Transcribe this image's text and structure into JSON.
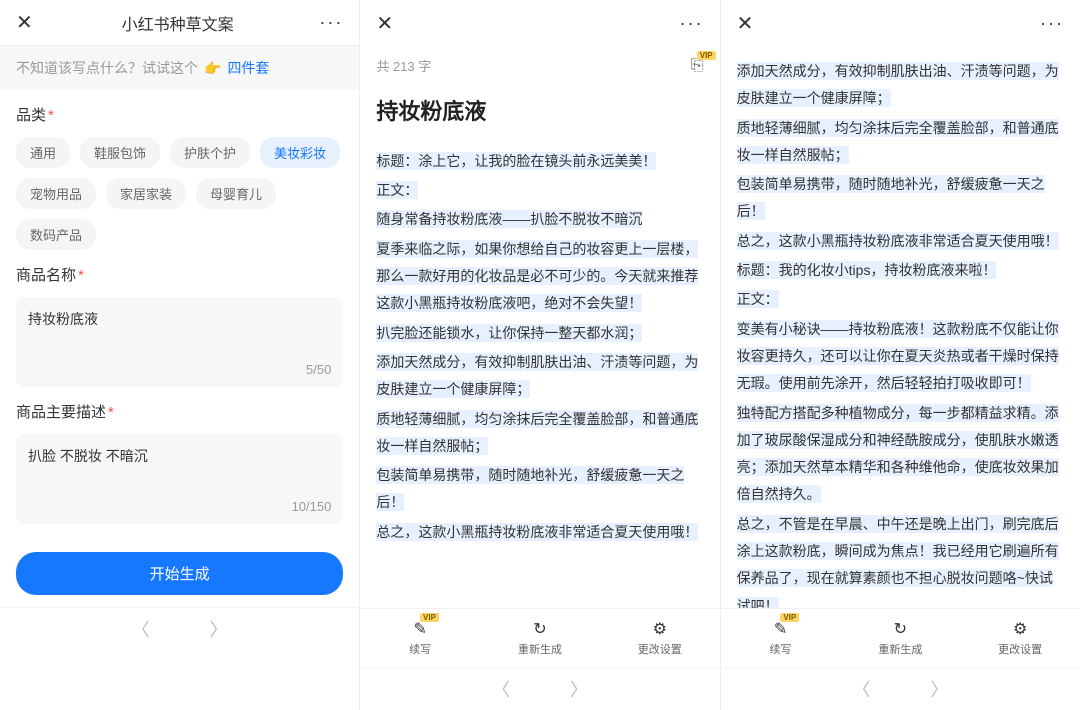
{
  "panel1": {
    "title": "小红书种草文案",
    "prompt_text": "不知道该写点什么？试试这个",
    "prompt_link": "四件套",
    "category": {
      "label": "品类",
      "chips": [
        "通用",
        "鞋服包饰",
        "护肤个护",
        "美妆彩妆",
        "宠物用品",
        "家居家装",
        "母婴育儿",
        "数码产品"
      ],
      "active_index": 3
    },
    "product_name": {
      "label": "商品名称",
      "value": "持妆粉底液",
      "counter": "5/50"
    },
    "product_desc": {
      "label": "商品主要描述",
      "value": "扒脸 不脱妆 不暗沉",
      "counter": "10/150"
    },
    "generate_button": "开始生成"
  },
  "panel2": {
    "word_count": "共 213 字",
    "vip_tag": "VIP",
    "title": "持妆粉底液",
    "paragraphs": [
      "标题：涂上它，让我的脸在镜头前永远美美！",
      "正文：",
      "随身常备持妆粉底液——扒脸不脱妆不暗沉",
      "夏季来临之际，如果你想给自己的妆容更上一层楼，那么一款好用的化妆品是必不可少的。今天就来推荐这款小黑瓶持妆粉底液吧，绝对不会失望！",
      "扒完脸还能锁水，让你保持一整天都水润；",
      "添加天然成分，有效抑制肌肤出油、汗渍等问题，为皮肤建立一个健康屏障；",
      "质地轻薄细腻，均匀涂抹后完全覆盖脸部，和普通底妆一样自然服帖；",
      "包装简单易携带，随时随地补光，舒缓疲惫一天之后！",
      "总之，这款小黑瓶持妆粉底液非常适合夏天使用哦！"
    ],
    "actions": {
      "continue": "续写",
      "regenerate": "重新生成",
      "settings": "更改设置"
    }
  },
  "panel3": {
    "paragraphs": [
      "添加天然成分，有效抑制肌肤出油、汗渍等问题，为皮肤建立一个健康屏障；",
      "质地轻薄细腻，均匀涂抹后完全覆盖脸部，和普通底妆一样自然服帖；",
      "包装简单易携带，随时随地补光，舒缓疲惫一天之后！",
      "总之，这款小黑瓶持妆粉底液非常适合夏天使用哦！",
      "标题：我的化妆小tips，持妆粉底液来啦！",
      "正文：",
      "变美有小秘诀——持妆粉底液！这款粉底不仅能让你妆容更持久，还可以让你在夏天炎热或者干燥时保持无瑕。使用前先涂开，然后轻轻拍打吸收即可！",
      "独特配方搭配多种植物成分，每一步都精益求精。添加了玻尿酸保湿成分和神经酰胺成分，使肌肤水嫩透亮；添加天然草本精华和各种维他命，使底妆效果加倍自然持久。",
      "总之，不管是在早晨、中午还是晚上出门，刷完底后涂上这款粉底，瞬间成为焦点！我已经用它刷遍所有保养品了，现在就算素颜也不担心脱妆问题咯~快试试吧！"
    ],
    "actions": {
      "continue": "续写",
      "regenerate": "重新生成",
      "settings": "更改设置"
    },
    "vip_tag": "VIP"
  }
}
